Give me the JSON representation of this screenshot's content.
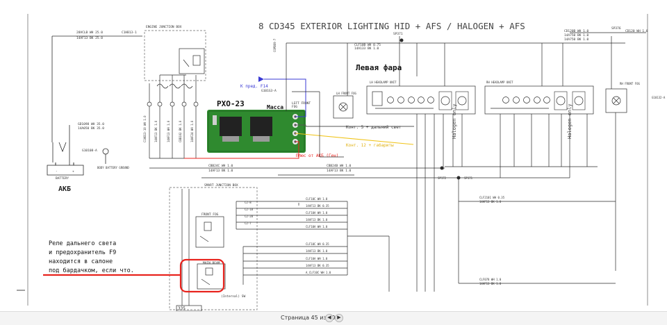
{
  "diagram": {
    "title": "8  CD345  EXTERIOR LIGHTING HID + AFS / HALOGEN + AFS",
    "annotations": {
      "akb": "АКБ",
      "rho": "РХО-23",
      "massa": "Масса",
      "k_pred": "К пред. F14",
      "left_headlamp": "Левая фара",
      "kont5": "Конт. 5 + дальний свет",
      "kont12": "Конт. 12 + габариты",
      "plus_akb": "Плюс от АКБ (Ген)",
      "note_lines": [
        "Реле дальнего света",
        "и предохранитель F9",
        "находится в салоне",
        "под бардачком, если что."
      ]
    },
    "labels": {
      "battery": "BATTERY",
      "body_battery_ground": "BODY BATTERY GROUND",
      "engine_box": "ENGINE JUNCTION BOX",
      "smart_box": "SMART JUNCTION BOX",
      "front_fog": "FRONT FOG",
      "main_beam": "MAIN BEAM",
      "lh_front_fog": "LH FRONT FOG",
      "rh_front_fog": "RH FRONT FOG",
      "lh_headlamp": "LH HEADLAMP UNIT",
      "rh_headlamp": "RH HEADLAMP UNIT",
      "halogen_lh": "Halogen only",
      "halogen_rh": "Halogen only",
      "left_front_fog": "LEFT FRONT FOG",
      "internal": "(Internal) SW",
      "small_box": "335"
    },
    "colors": {
      "red": "#e8231d",
      "blue": "#3a3ad4",
      "yellow": "#f0c419",
      "wire": "#2a2a2a",
      "pcb": "#2f8a2f"
    }
  },
  "status": {
    "page_text": "Страница 45 из 109",
    "prev_icon": "◀",
    "next_icon": "▶"
  }
}
